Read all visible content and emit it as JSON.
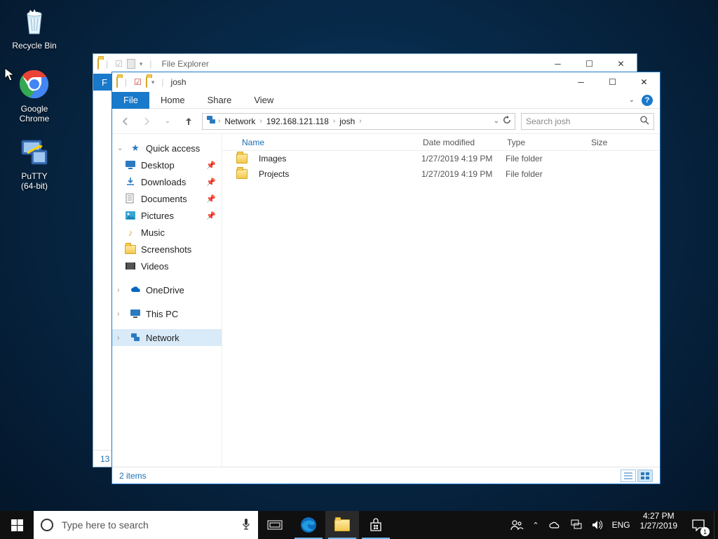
{
  "desktop": {
    "icons": [
      {
        "name": "recycle-bin",
        "label": "Recycle Bin"
      },
      {
        "name": "google-chrome",
        "label": "Google\nChrome"
      },
      {
        "name": "putty",
        "label": "PuTTY\n(64-bit)"
      }
    ]
  },
  "background_window": {
    "title": "File Explorer",
    "ribbon_file": "F",
    "status": "13"
  },
  "window": {
    "title": "josh",
    "ribbon": {
      "file": "File",
      "tabs": [
        "Home",
        "Share",
        "View"
      ]
    },
    "breadcrumb": [
      "Network",
      "192.168.121.118",
      "josh"
    ],
    "search_placeholder": "Search josh",
    "nav": {
      "quick_access": "Quick access",
      "items": [
        {
          "label": "Desktop",
          "pinned": true,
          "icon": "desktop"
        },
        {
          "label": "Downloads",
          "pinned": true,
          "icon": "downloads"
        },
        {
          "label": "Documents",
          "pinned": true,
          "icon": "documents"
        },
        {
          "label": "Pictures",
          "pinned": true,
          "icon": "pictures"
        },
        {
          "label": "Music",
          "pinned": false,
          "icon": "music"
        },
        {
          "label": "Screenshots",
          "pinned": false,
          "icon": "folder"
        },
        {
          "label": "Videos",
          "pinned": false,
          "icon": "videos"
        }
      ],
      "onedrive": "OneDrive",
      "this_pc": "This PC",
      "network": "Network"
    },
    "columns": [
      "Name",
      "Date modified",
      "Type",
      "Size"
    ],
    "rows": [
      {
        "name": "Images",
        "date": "1/27/2019 4:19 PM",
        "type": "File folder",
        "size": ""
      },
      {
        "name": "Projects",
        "date": "1/27/2019 4:19 PM",
        "type": "File folder",
        "size": ""
      }
    ],
    "status": "2 items"
  },
  "taskbar": {
    "search_placeholder": "Type here to search",
    "lang": "ENG",
    "time": "4:27 PM",
    "date": "1/27/2019",
    "notif_count": "1"
  }
}
